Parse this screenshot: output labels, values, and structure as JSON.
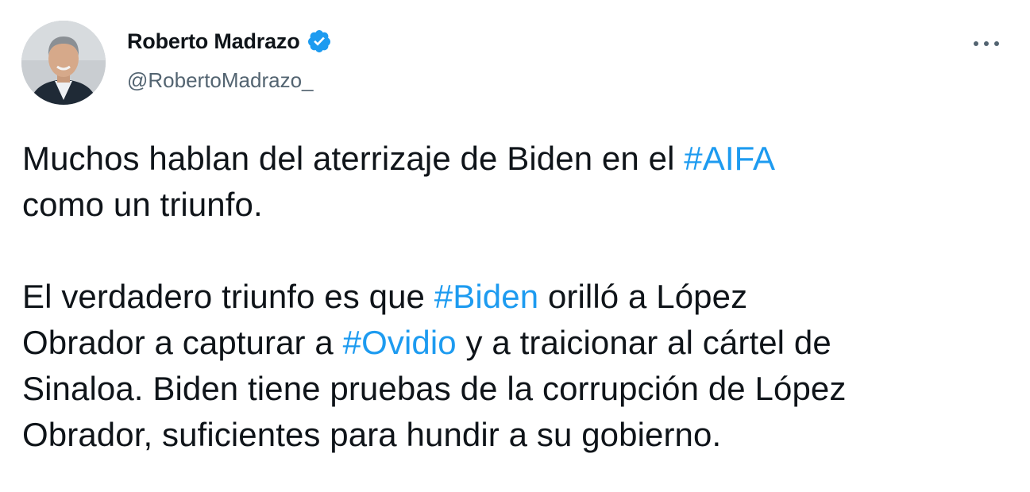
{
  "author": {
    "display_name": "Roberto Madrazo",
    "handle": "@RobertoMadrazo_",
    "verified": true,
    "avatar_icon": "profile-photo-icon"
  },
  "menu": {
    "icon": "more-horizontal-icon"
  },
  "colors": {
    "hashtag": "#1d9bf0",
    "verified_badge": "#1d9bf0",
    "secondary_text": "#536471"
  },
  "tweet": {
    "p1": {
      "t1": "Muchos hablan del aterrizaje de Biden en el ",
      "h1": "#AIFA",
      "t2": "como un triunfo."
    },
    "p2": {
      "t1": "El verdadero triunfo es que ",
      "h1": "#Biden",
      "t2": " orilló a López",
      "t3": "Obrador a capturar a ",
      "h2": "#Ovidio",
      "t4": " y a traicionar al cártel de",
      "t5": "Sinaloa. Biden tiene pruebas de la corrupción de López",
      "t6": "Obrador, suficientes para hundir a su gobierno."
    }
  }
}
